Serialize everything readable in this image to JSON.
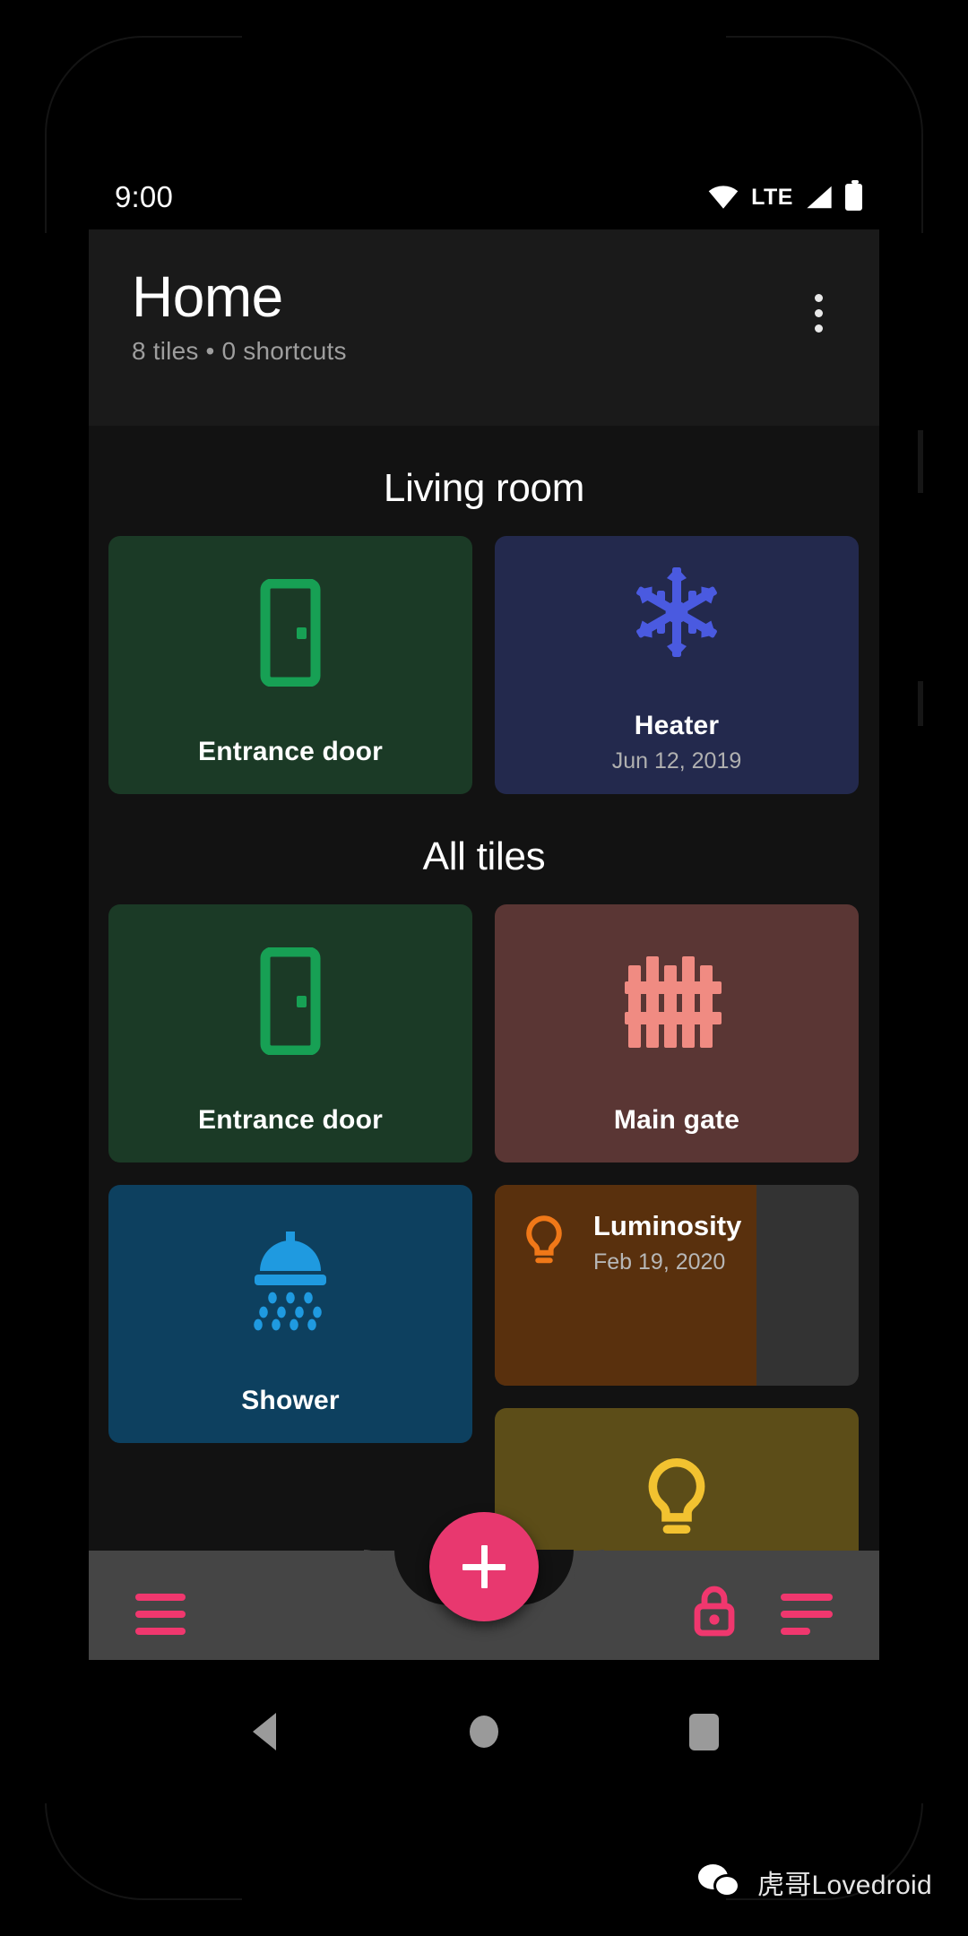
{
  "status_bar": {
    "time": "9:00",
    "network_label": "LTE",
    "icons": [
      "wifi-icon",
      "signal-icon",
      "battery-icon"
    ]
  },
  "header": {
    "title": "Home",
    "subtitle": "8 tiles • 0 shortcuts",
    "overflow_menu": "more-options-icon"
  },
  "sections": [
    {
      "title": "Living room",
      "tiles": [
        {
          "label": "Entrance door",
          "subtitle": "",
          "icon": "door-icon",
          "bg": "#1b3a26",
          "fg": "#17a054"
        },
        {
          "label": "Heater",
          "subtitle": "Jun 12, 2019",
          "icon": "snowflake-icon",
          "bg": "#23294d",
          "fg": "#4a5ae0"
        }
      ]
    },
    {
      "title": "All tiles",
      "tiles": [
        {
          "label": "Entrance door",
          "subtitle": "",
          "icon": "door-icon",
          "bg": "#1b3a26",
          "fg": "#17a054"
        },
        {
          "label": "Main gate",
          "subtitle": "",
          "icon": "gate-icon",
          "bg": "#5a3634",
          "fg": "#f08b82"
        },
        {
          "label": "Shower",
          "subtitle": "",
          "icon": "shower-icon",
          "bg": "#0d405f",
          "fg": "#1f9ae0"
        },
        {
          "label": "Luminosity",
          "subtitle": "Feb 19, 2020",
          "icon": "bulb-icon",
          "bg": "#333333",
          "fg": "#f07818",
          "fill_color": "#59300d",
          "fill_percent": 72
        },
        {
          "label": "",
          "subtitle": "",
          "icon": "bulb-icon",
          "bg": "#5c4d18",
          "fg": "#f2c230"
        },
        {
          "label": "",
          "subtitle": "",
          "icon": "snowflake-icon",
          "bg": "#23294d",
          "fg": "#4a5ae0"
        }
      ]
    }
  ],
  "bottom_bar": {
    "menu_icon": "hamburger-menu-icon",
    "lock_icon": "lock-icon",
    "sort_icon": "sort-icon",
    "fab_label": "+",
    "accent": "#e8386f"
  },
  "nav_bar": {
    "back": "back-triangle-icon",
    "home": "home-circle-icon",
    "recents": "recents-square-icon"
  },
  "watermark": {
    "text": "虎哥Lovedroid",
    "logo": "wechat-icon"
  }
}
